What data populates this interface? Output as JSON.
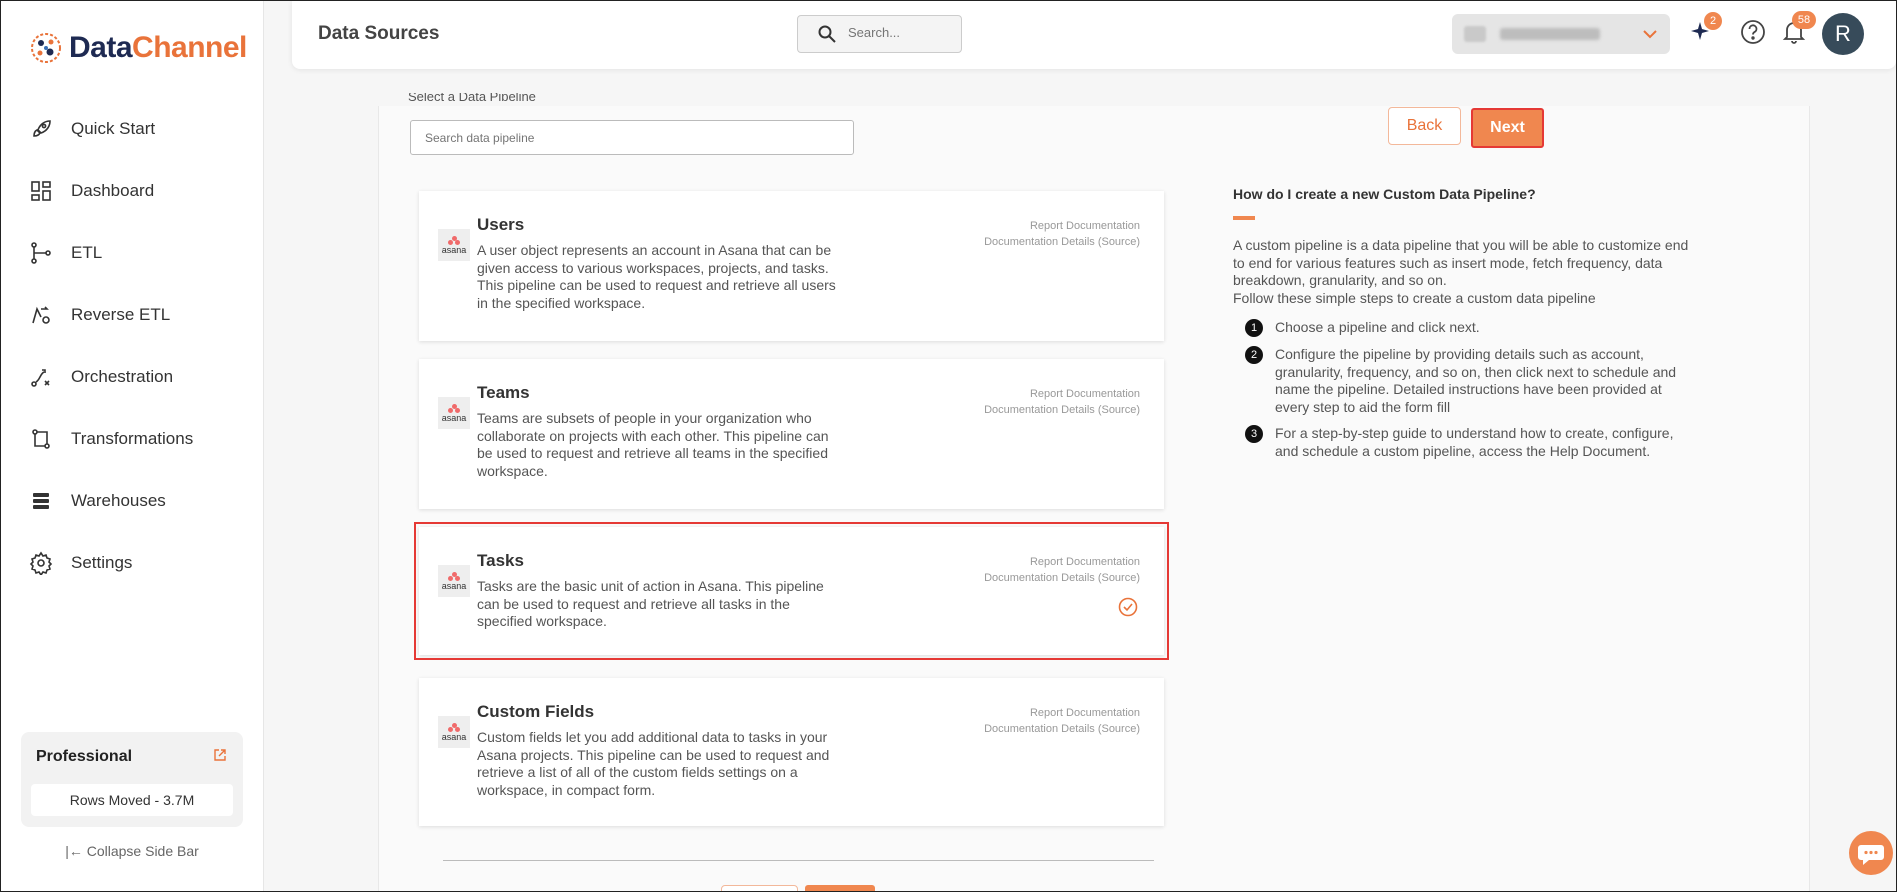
{
  "brand": {
    "name_part1": "Data",
    "name_part2": "Channel",
    "accent": "#e9733a",
    "dark": "#1e2a52"
  },
  "sidebar": {
    "items": [
      {
        "label": "Quick Start",
        "icon": "rocket-icon"
      },
      {
        "label": "Dashboard",
        "icon": "dashboard-icon"
      },
      {
        "label": "ETL",
        "icon": "etl-icon"
      },
      {
        "label": "Reverse ETL",
        "icon": "reverse-etl-icon"
      },
      {
        "label": "Orchestration",
        "icon": "orchestration-icon"
      },
      {
        "label": "Transformations",
        "icon": "transformations-icon"
      },
      {
        "label": "Warehouses",
        "icon": "warehouses-icon"
      },
      {
        "label": "Settings",
        "icon": "gear-icon"
      }
    ],
    "plan": {
      "title": "Professional",
      "rows_moved": "Rows Moved - 3.7M"
    },
    "collapse_label": "Collapse Side Bar"
  },
  "header": {
    "title": "Data Sources",
    "search_placeholder": "Search...",
    "sparkle_badge": "2",
    "notification_badge": "58",
    "avatar_initial": "R"
  },
  "main": {
    "section_label": "Select a Data Pipeline",
    "search_placeholder": "Search data pipeline",
    "back_label": "Back",
    "next_label": "Next",
    "pipelines": [
      {
        "name": "Users",
        "logo_text": "asana",
        "description": "A user object represents an account in Asana that can be given access to various workspaces, projects, and tasks. This pipeline can be used to request and retrieve all users in the specified workspace.",
        "link1": "Report Documentation",
        "link2": "Documentation Details (Source)",
        "selected": false
      },
      {
        "name": "Teams",
        "logo_text": "asana",
        "description": "Teams are subsets of people in your organization who collaborate on projects with each other. This pipeline can be used to request and retrieve all teams in the specified workspace.",
        "link1": "Report Documentation",
        "link2": "Documentation Details (Source)",
        "selected": false
      },
      {
        "name": "Tasks",
        "logo_text": "asana",
        "description": "Tasks are the basic unit of action in Asana. This pipeline can be used to request and retrieve all tasks in the specified workspace.",
        "link1": "Report Documentation",
        "link2": "Documentation Details (Source)",
        "selected": true
      },
      {
        "name": "Custom Fields",
        "logo_text": "asana",
        "description": "Custom fields let you add additional data to tasks in your Asana projects. This pipeline can be used to request and retrieve a list of all of the custom fields settings on a workspace, in compact form.",
        "link1": "Report Documentation",
        "link2": "Documentation Details (Source)",
        "selected": false
      }
    ]
  },
  "help": {
    "title": "How do I create a new Custom Data Pipeline?",
    "intro": "A custom pipeline is a data pipeline that you will be able to customize end to end for various features such as insert mode, fetch frequency, data breakdown, granularity, and so on.",
    "intro2": "Follow these simple steps to create a custom data pipeline",
    "steps": [
      {
        "num": "1",
        "text": "Choose a pipeline and click next."
      },
      {
        "num": "2",
        "text": "Configure the pipeline by providing details such as account, granularity, frequency, and so on, then click next to schedule and name the pipeline. Detailed instructions have been provided at every step to aid the form fill"
      },
      {
        "num": "3",
        "text": "For a step-by-step guide to understand how to create, configure, and schedule a custom pipeline, access the Help Document."
      }
    ]
  }
}
